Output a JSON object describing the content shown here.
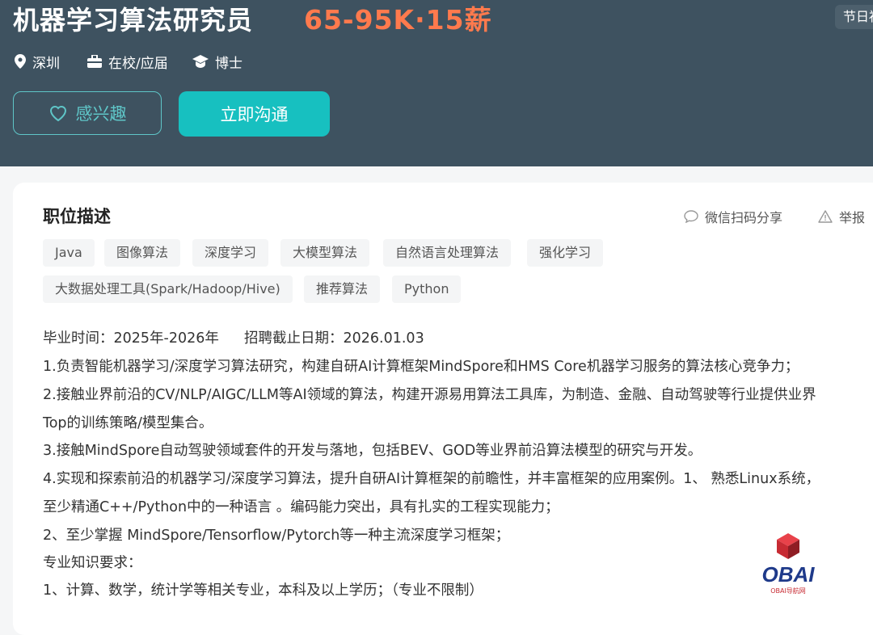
{
  "header": {
    "title": "机器学习算法研究员",
    "salary": "65-95K·15薪",
    "holiday_badge": "节日福",
    "meta": [
      {
        "icon": "location-icon",
        "text": "深圳"
      },
      {
        "icon": "briefcase-icon",
        "text": "在校/应届"
      },
      {
        "icon": "graduation-cap-icon",
        "text": "博士"
      }
    ],
    "interest_label": "感兴趣",
    "chat_label": "立即沟通"
  },
  "colors": {
    "header_bg": "#3e5260",
    "accent": "#17c0c0",
    "salary": "#ff7a4d"
  },
  "description": {
    "title": "职位描述",
    "share_label": "微信扫码分享",
    "report_label": "举报",
    "tags": [
      "Java",
      "图像算法",
      "深度学习",
      "大模型算法",
      "自然语言处理算法",
      "强化学习",
      "大数据处理工具(Spark/Hadoop/Hive)",
      "推荐算法",
      "Python"
    ],
    "graduation": "毕业时间：2025年-2026年",
    "deadline": "招聘截止日期：2026.01.03",
    "lines": [
      "1.负责智能机器学习/深度学习算法研究，构建自研AI计算框架MindSpore和HMS Core机器学习服务的算法核心竞争力；",
      "2.接触业界前沿的CV/NLP/AIGC/LLM等AI领域的算法，构建开源易用算法工具库，为制造、金融、自动驾驶等行业提供业界",
      "Top的训练策略/模型集合。",
      "3.接触MindSpore自动驾驶领域套件的开发与落地，包括BEV、GOD等业界前沿算法模型的研究与开发。",
      "4.实现和探索前沿的机器学习/深度学习算法，提升自研AI计算框架的前瞻性，并丰富框架的应用案例。1、 熟悉Linux系统，",
      "至少精通C++/Python中的一种语言 。编码能力突出，具有扎实的工程实现能力；",
      "2、至少掌握 MindSpore/Tensorflow/Pytorch等一种主流深度学习框架；",
      "专业知识要求：",
      "1、计算、数学，统计学等相关专业，本科及以上学历；（专业不限制）"
    ]
  },
  "watermark": {
    "brand": "OBAI",
    "subtitle": "OBAI导航网"
  }
}
